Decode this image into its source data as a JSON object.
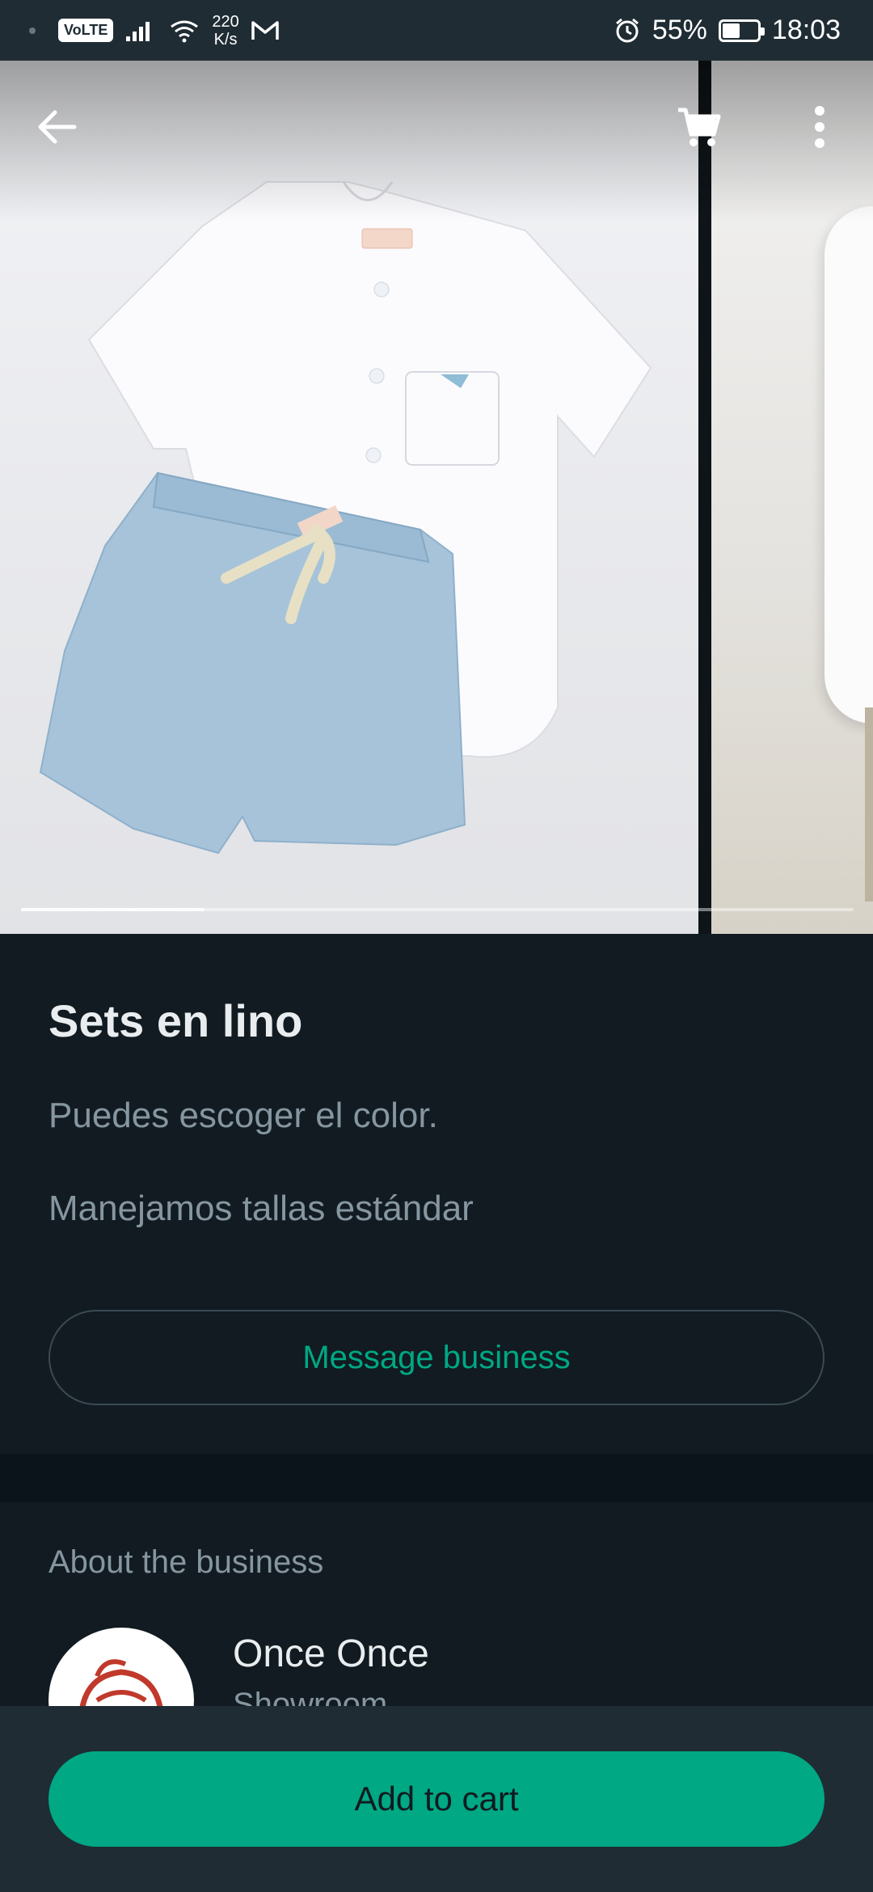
{
  "status_bar": {
    "network_speed": "220",
    "network_unit": "K/s",
    "volte": "VoLTE",
    "battery_percent": "55%",
    "time": "18:03",
    "battery_level": 0.55
  },
  "gallery": {
    "progress_fraction": 0.22
  },
  "product": {
    "title": "Sets en lino",
    "description_line1": "Puedes escoger el color.",
    "description_line2": "Manejamos tallas estándar",
    "message_label": "Message business"
  },
  "about": {
    "section_label": "About the business",
    "business_name": "Once Once",
    "business_category": "Showroom"
  },
  "bottom": {
    "add_to_cart_label": "Add to cart"
  },
  "colors": {
    "accent": "#00a884",
    "background": "#111b21",
    "header": "#1f2c34"
  }
}
